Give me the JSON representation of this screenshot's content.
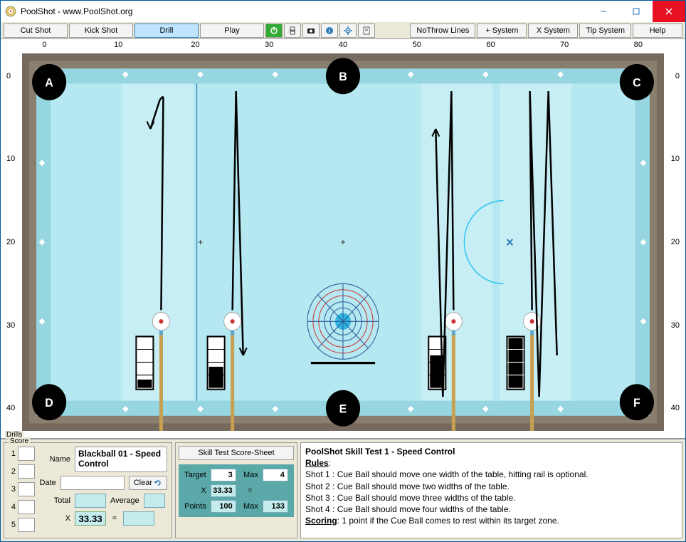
{
  "window": {
    "title": "PoolShot - www.PoolShot.org"
  },
  "toolbar": {
    "cut_shot": "Cut Shot",
    "kick_shot": "Kick Shot",
    "drill": "Drill",
    "play": "Play",
    "no_throw": "NoThrow Lines",
    "plus_system": "+ System",
    "x_system": "X System",
    "tip_system": "Tip System",
    "help": "Help"
  },
  "ruler": {
    "top": [
      "0",
      "10",
      "20",
      "30",
      "40",
      "50",
      "60",
      "70",
      "80"
    ],
    "side": [
      "0",
      "10",
      "20",
      "30",
      "40"
    ]
  },
  "pockets": {
    "A": "A",
    "B": "B",
    "C": "C",
    "D": "D",
    "E": "E",
    "F": "F"
  },
  "score_panel": {
    "group_label": "Score",
    "drills_label": "Drills",
    "name_label": "Name",
    "name_value": "Blackball 01 - Speed Control",
    "date_label": "Date",
    "clear_label": "Clear",
    "total_label": "Total",
    "average_label": "Average",
    "x_label": "X",
    "x_value": "33.33",
    "eq_label": "=",
    "rows": [
      "1",
      "2",
      "3",
      "4",
      "5"
    ]
  },
  "sheet": {
    "button": "Skill Test Score-Sheet",
    "target_label": "Target",
    "target_value": "3",
    "max1_label": "Max",
    "max1_value": "4",
    "x_label": "X",
    "x_value": "33.33",
    "eq_label": "=",
    "points_label": "Points",
    "points_value": "100",
    "max2_label": "Max",
    "max2_value": "133"
  },
  "rules": {
    "title": "PoolShot Skill Test 1 - Speed Control",
    "rules_label": "Rules",
    "shot1": "Shot 1 : Cue Ball should move one width of the table, hitting rail is optional.",
    "shot2": "Shot 2 : Cue Ball should move two widths of the table.",
    "shot3": "Shot 3 : Cue Ball should move three widths of the table.",
    "shot4": "Shot 4 : Cue Ball should move four widths of the table.",
    "scoring_label": "Scoring",
    "scoring_text": ": 1 point if the Cue Ball comes to rest within its target zone."
  }
}
